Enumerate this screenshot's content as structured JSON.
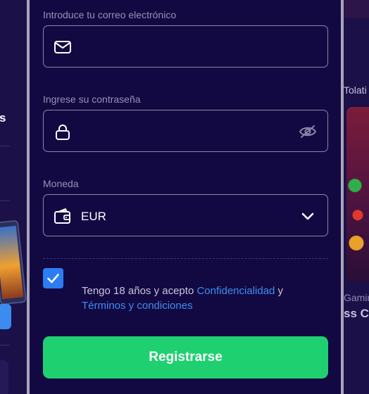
{
  "background": {
    "left_fragment_text": "s",
    "right_top_text": "Tolati",
    "right_mid_text": "Gamin",
    "right_bottom_text": "ss C"
  },
  "form": {
    "email": {
      "label": "Introduce tu correo electrónico",
      "value": "",
      "icon": "mail-icon"
    },
    "password": {
      "label": "Ingrese su contraseña",
      "value": "",
      "icon": "lock-icon",
      "toggle_icon": "eye-off-icon"
    },
    "currency": {
      "label": "Moneda",
      "selected": "EUR",
      "icon": "wallet-icon",
      "dropdown_icon": "chevron-down-icon"
    },
    "terms": {
      "checked": true,
      "prefix": "Tengo 18 años y acepto ",
      "privacy_link": "Confidencialidad",
      "joiner": " y",
      "terms_link": "Términos y condiciones"
    },
    "submit_label": "Registrarse"
  },
  "colors": {
    "modal_bg": "#130942",
    "border": "#8b86a8",
    "accent_green": "#1fd070",
    "link_blue": "#3d8ef5",
    "checkbox_blue": "#2b7df2"
  }
}
